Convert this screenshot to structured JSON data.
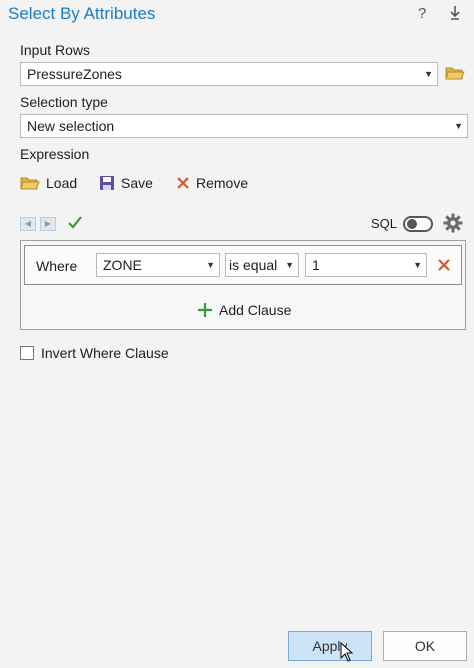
{
  "window": {
    "title": "Select By Attributes",
    "help_label": "?",
    "pin_label": "⇩"
  },
  "input_rows": {
    "label": "Input Rows",
    "value": "PressureZones"
  },
  "selection_type": {
    "label": "Selection type",
    "value": "New selection"
  },
  "expression": {
    "label": "Expression",
    "load_label": "Load",
    "save_label": "Save",
    "remove_label": "Remove",
    "sql_label": "SQL"
  },
  "clause": {
    "where_label": "Where",
    "field": "ZONE",
    "operator": "is equal",
    "value": "1",
    "add_clause_label": "Add Clause"
  },
  "invert": {
    "label": "Invert Where Clause",
    "checked": false
  },
  "buttons": {
    "apply_label": "Apply",
    "ok_label": "OK"
  },
  "colors": {
    "title": "#1a7cc9",
    "remove_x": "#d8572a",
    "check": "#3a9a3a",
    "add_plus": "#3a9a3a",
    "folder": "#e0b24a",
    "apply_bg": "#cde3f7"
  }
}
